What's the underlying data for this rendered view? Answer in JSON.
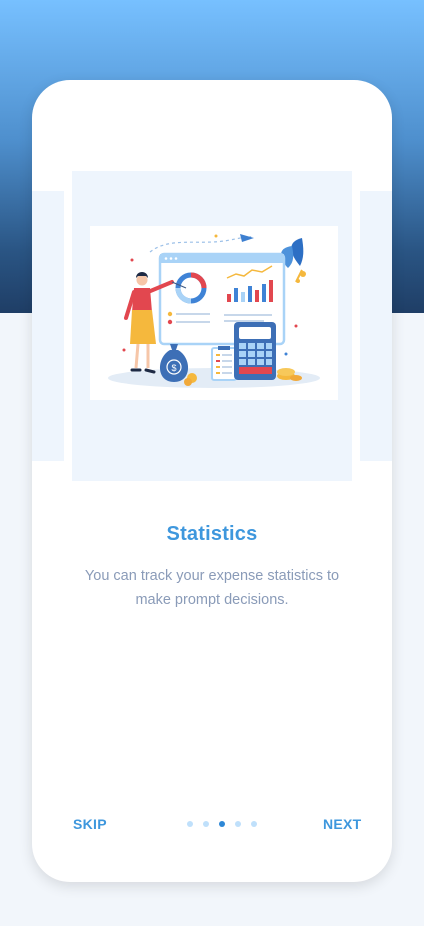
{
  "slide": {
    "title": "Statistics",
    "description": "You can track your expense statistics to make prompt decisions."
  },
  "nav": {
    "skip_label": "SKIP",
    "next_label": "NEXT",
    "page_count": 5,
    "active_page": 3
  },
  "colors": {
    "accent": "#3e97dd",
    "dot_active": "#2d87d6",
    "dot_inactive": "#bfe0fb",
    "header_top": "#77c0ff",
    "header_bottom": "#1f3e66"
  }
}
